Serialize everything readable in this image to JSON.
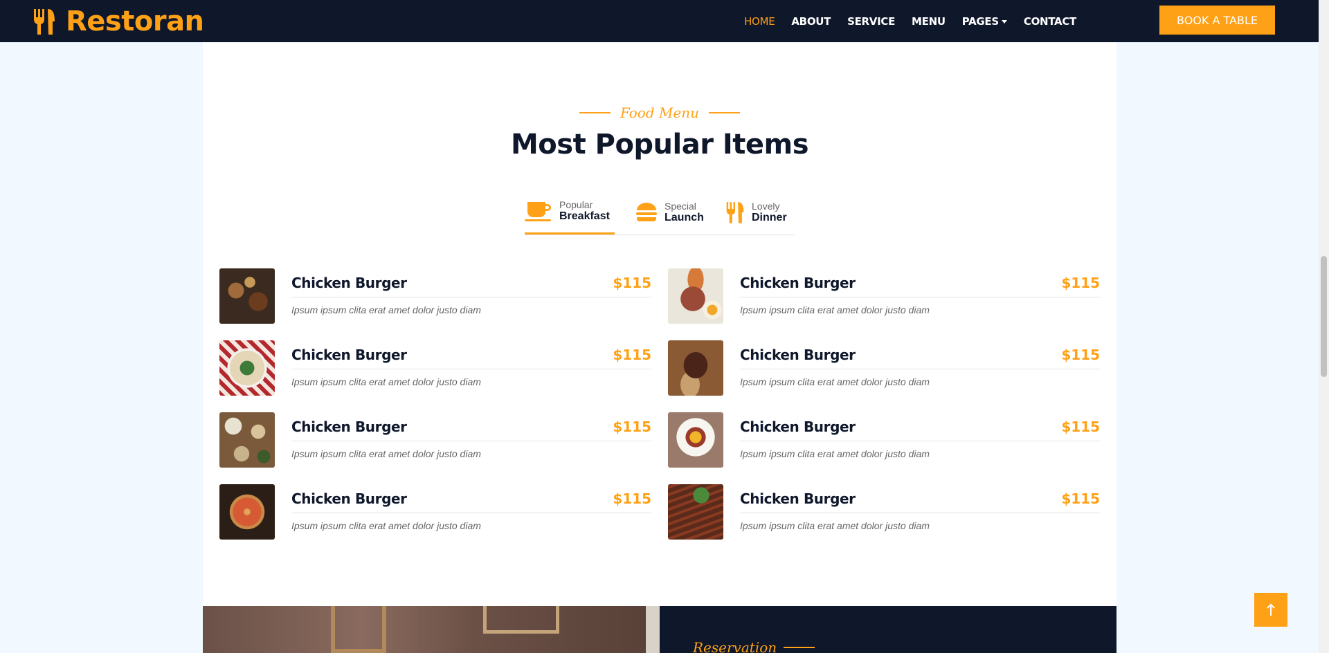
{
  "brand": {
    "name": "Restoran",
    "icon": "utensils-icon"
  },
  "nav": {
    "links": [
      "HOME",
      "ABOUT",
      "SERVICE",
      "MENU",
      "PAGES",
      "CONTACT"
    ],
    "book_label": "BOOK A TABLE"
  },
  "section": {
    "subtitle": "Food Menu",
    "title": "Most Popular Items"
  },
  "tabs": [
    {
      "small": "Popular",
      "big": "Breakfast",
      "icon": "coffee-icon",
      "active": true
    },
    {
      "small": "Special",
      "big": "Launch",
      "icon": "hamburger-icon",
      "active": false
    },
    {
      "small": "Lovely",
      "big": "Dinner",
      "icon": "utensils-icon",
      "active": false
    }
  ],
  "menu_items": [
    {
      "name": "Chicken Burger",
      "price": "$115",
      "desc": "Ipsum ipsum clita erat amet dolor justo diam"
    },
    {
      "name": "Chicken Burger",
      "price": "$115",
      "desc": "Ipsum ipsum clita erat amet dolor justo diam"
    },
    {
      "name": "Chicken Burger",
      "price": "$115",
      "desc": "Ipsum ipsum clita erat amet dolor justo diam"
    },
    {
      "name": "Chicken Burger",
      "price": "$115",
      "desc": "Ipsum ipsum clita erat amet dolor justo diam"
    },
    {
      "name": "Chicken Burger",
      "price": "$115",
      "desc": "Ipsum ipsum clita erat amet dolor justo diam"
    },
    {
      "name": "Chicken Burger",
      "price": "$115",
      "desc": "Ipsum ipsum clita erat amet dolor justo diam"
    },
    {
      "name": "Chicken Burger",
      "price": "$115",
      "desc": "Ipsum ipsum clita erat amet dolor justo diam"
    },
    {
      "name": "Chicken Burger",
      "price": "$115",
      "desc": "Ipsum ipsum clita erat amet dolor justo diam"
    }
  ],
  "reservation": {
    "label": "Reservation"
  },
  "colors": {
    "accent": "#fea116",
    "dark": "#0f172b"
  }
}
